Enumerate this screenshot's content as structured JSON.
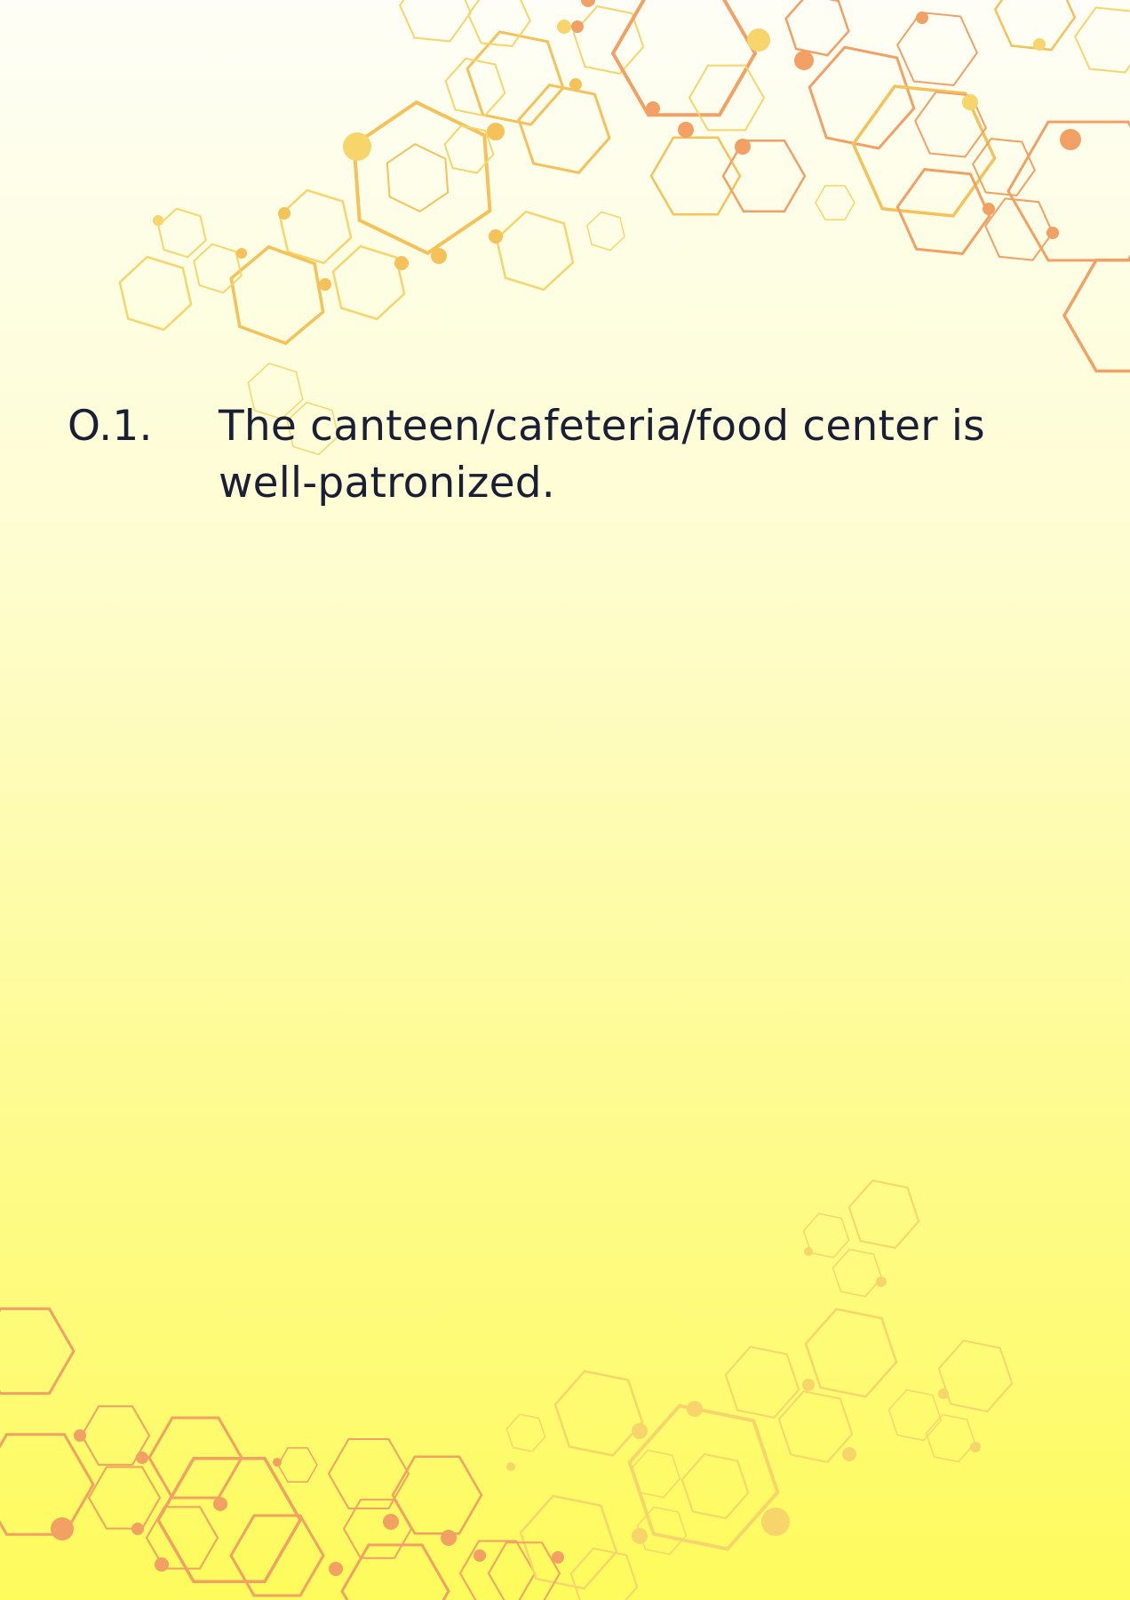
{
  "colors": {
    "background_top": "#fefef4",
    "background_bottom": "#fefb60",
    "text": "#1a1f36",
    "hex_light": "#f7d56a",
    "hex_mid": "#f5c25a",
    "hex_orange": "#f2a064"
  },
  "decoration": {
    "top_right": "hexagon-molecule-pattern",
    "bottom_left": "hexagon-molecule-pattern"
  },
  "question": {
    "number": "O.1.",
    "text": "The canteen/cafeteria/food center is well-patronized."
  }
}
